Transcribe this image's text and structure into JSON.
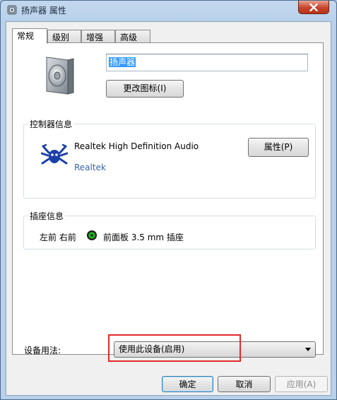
{
  "window": {
    "title": "扬声器 属性",
    "close_icon": "close-icon",
    "colors": {
      "frame": "#b8d0ea",
      "close": "#c7432a",
      "highlight_box": "#e22b2b",
      "vendor_link": "#3465a4"
    }
  },
  "tabs": [
    {
      "label": "常规",
      "active": true
    },
    {
      "label": "级别",
      "active": false
    },
    {
      "label": "增强",
      "active": false
    },
    {
      "label": "高级",
      "active": false
    }
  ],
  "general": {
    "device_icon": "speaker-icon",
    "name_value": "扬声器",
    "change_icon_button": "更改图标(I)"
  },
  "controller": {
    "group_label": "控制器信息",
    "icon": "realtek-crab-icon",
    "name": "Realtek High Definition Audio",
    "vendor": "Realtek",
    "properties_button": "属性(P)"
  },
  "jack": {
    "group_label": "插座信息",
    "channels": "左前 右前",
    "jack_icon": "green-jack-icon",
    "jack_color": "#1fb61f",
    "description": "前面板 3.5 mm 插座"
  },
  "device_usage": {
    "label": "设备用法:",
    "selected": "使用此设备(启用)"
  },
  "buttons": {
    "ok": "确定",
    "cancel": "取消",
    "apply": "应用(A)"
  }
}
